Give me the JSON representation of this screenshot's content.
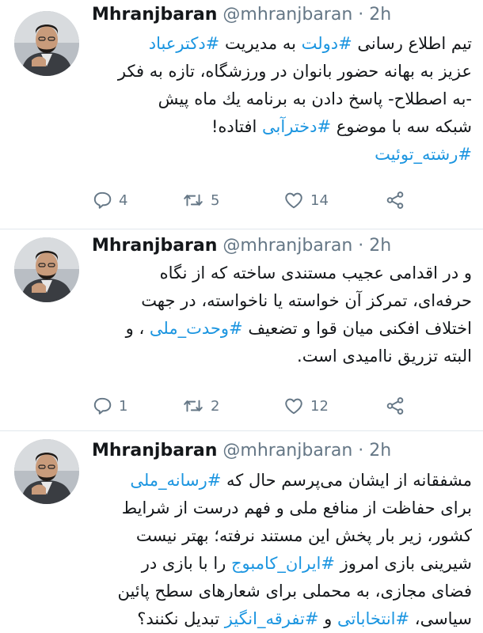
{
  "tweets": [
    {
      "name": "Mhranjbaran",
      "handle": "@mhranjbaran",
      "dot": "·",
      "time": "2h",
      "lines": [
        [
          "تیم اطلاع رسانی ",
          "#دولت",
          " به مدیریت ",
          "#دکترعباد"
        ],
        [
          "عزیز به بهانه حضور بانوان در ورزشگاه، تازه به فکر"
        ],
        [
          "-به اصطلاح- پاسخ دادن به برنامه یك ماه پیش"
        ],
        [
          "شبکه سه با موضوع ",
          "#دخترآبی",
          " افتاده!"
        ],
        [
          "#رشته_توئیت"
        ]
      ],
      "replies": "4",
      "retweets": "5",
      "likes": "14"
    },
    {
      "name": "Mhranjbaran",
      "handle": "@mhranjbaran",
      "dot": "·",
      "time": "2h",
      "lines": [
        [
          "و در اقدامی عجیب مستندی ساخته که از نگاه"
        ],
        [
          "حرفه‌ای، تمرکز آن خواسته یا ناخواسته، در جهت"
        ],
        [
          "اختلاف افکنی میان قوا و تضعیف ",
          "#وحدت_ملی",
          " ، و"
        ],
        [
          "البته تزریق ناامیدی است."
        ]
      ],
      "replies": "1",
      "retweets": "2",
      "likes": "12"
    },
    {
      "name": "Mhranjbaran",
      "handle": "@mhranjbaran",
      "dot": "·",
      "time": "2h",
      "lines": [
        [
          "مشفقانه از ایشان می‌پرسم حال که ",
          "#رسانه_ملی"
        ],
        [
          "برای حفاظت از منافع ملی و فهم درست از شرایط"
        ],
        [
          "کشور، زیر بار پخش این مستند نرفته؛ بهتر نیست"
        ],
        [
          "شیرینی بازی امروز ",
          "#ایران_کامبوج",
          " را با بازی در"
        ],
        [
          "فضای مجازی، به محملی برای شعارهای سطح پائین"
        ],
        [
          "سیاسی، ",
          "#انتخاباتی",
          " و ",
          "#تفرقه_انگیز",
          " تبدیل نکنند؟"
        ]
      ]
    }
  ],
  "colors": {
    "text": "#14171a",
    "secondary": "#657786",
    "link": "#1b95e0",
    "divider": "#e1e8ed"
  },
  "icons": [
    "reply-icon",
    "retweet-icon",
    "like-icon",
    "share-icon"
  ]
}
